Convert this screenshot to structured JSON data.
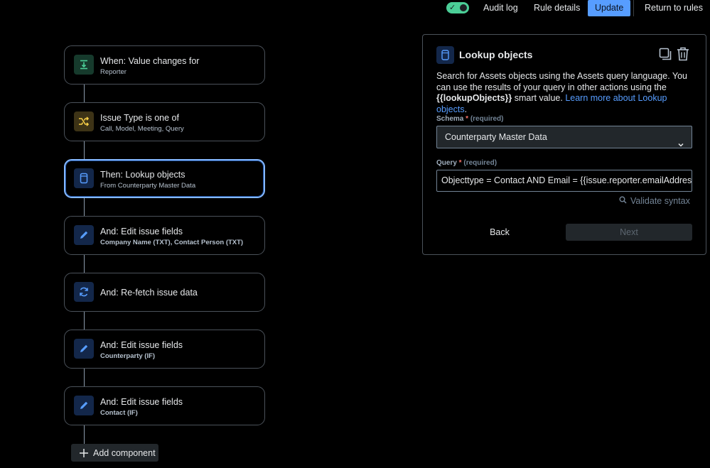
{
  "topbar": {
    "toggle_state": "on",
    "audit_log_label": "Audit log",
    "rule_details_label": "Rule details",
    "update_label": "Update",
    "return_label": "Return to rules"
  },
  "flow": {
    "components": [
      {
        "title": "When: Value changes for",
        "subtitle": "Reporter",
        "icon": "value-change-icon",
        "color": "#4bce97"
      },
      {
        "title": "Issue Type is one of",
        "subtitle": "Call, Model, Meeting, Query",
        "icon": "branch-condition-icon",
        "color": "#f5cd47"
      },
      {
        "title": "Then: Lookup objects",
        "subtitle": "From Counterparty Master Data",
        "icon": "lookup-objects-icon",
        "color": "#579dff",
        "selected": true
      },
      {
        "title": "And: Edit issue fields",
        "subtitle": "Company Name (TXT), Contact Person (TXT)",
        "icon": "pencil-icon",
        "color": "#579dff"
      },
      {
        "title": "And: Re-fetch issue data",
        "subtitle": "",
        "icon": "refresh-icon",
        "color": "#579dff"
      },
      {
        "title": "And: Edit issue fields",
        "subtitle": "Counterparty (IF)",
        "icon": "pencil-icon",
        "color": "#579dff"
      },
      {
        "title": "And: Edit issue fields",
        "subtitle": "Contact (IF)",
        "icon": "pencil-icon",
        "color": "#579dff"
      }
    ],
    "add_component_label": "Add component"
  },
  "panel": {
    "title": "Lookup objects",
    "desc_part1": "Search for Assets objects using the Assets query language. You can use the results of your query in other actions using the ",
    "desc_smart_value": "{{lookupObjects}}",
    "desc_part2": " smart value. ",
    "desc_link": "Learn more about Lookup objects",
    "desc_end": ".",
    "schema_label": "Schema",
    "required_text": "(required)",
    "schema_value": "Counterparty Master Data",
    "query_label": "Query",
    "query_value": "Objecttype = Contact AND Email = {{issue.reporter.emailAddress}}",
    "validate_label": "Validate syntax",
    "back_label": "Back",
    "next_label": "Next"
  }
}
